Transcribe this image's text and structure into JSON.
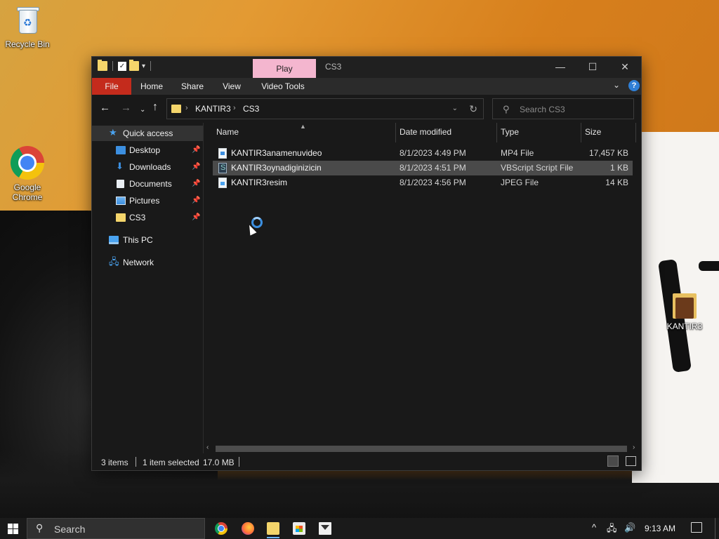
{
  "desktop": {
    "icons": [
      {
        "label": "Recycle Bin"
      },
      {
        "label": "Google Chrome"
      },
      {
        "label": "KANTIR3"
      }
    ]
  },
  "window": {
    "contextual_tab": "Play",
    "title": "CS3",
    "controls": {
      "minimize": "—",
      "maximize": "☐",
      "close": "✕"
    },
    "ribbon": {
      "tabs": [
        "File",
        "Home",
        "Share",
        "View",
        "Video Tools"
      ],
      "help": "?"
    },
    "address": {
      "crumbs": [
        "KANTIR3",
        "CS3"
      ]
    },
    "search": {
      "placeholder": "Search CS3"
    },
    "nav": {
      "items": [
        {
          "label": "Quick access",
          "icon": "star-icon"
        },
        {
          "label": "Desktop",
          "icon": "desktop-icon",
          "pinned": true
        },
        {
          "label": "Downloads",
          "icon": "download-icon",
          "pinned": true
        },
        {
          "label": "Documents",
          "icon": "documents-icon",
          "pinned": true
        },
        {
          "label": "Pictures",
          "icon": "pictures-icon",
          "pinned": true
        },
        {
          "label": "CS3",
          "icon": "folder-icon",
          "pinned": true
        },
        {
          "label": "This PC",
          "icon": "pc-icon"
        },
        {
          "label": "Network",
          "icon": "network-icon"
        }
      ]
    },
    "columns": [
      "Name",
      "Date modified",
      "Type",
      "Size"
    ],
    "files": [
      {
        "name": "KANTIR3anamenuvideo",
        "date": "8/1/2023 4:49 PM",
        "type": "MP4 File",
        "size": "17,457 KB",
        "icon": "video-file-icon"
      },
      {
        "name": "KANTIR3oynadiginizicin",
        "date": "8/1/2023 4:51 PM",
        "type": "VBScript Script File",
        "size": "1 KB",
        "icon": "script-file-icon",
        "selected": true
      },
      {
        "name": "KANTIR3resim",
        "date": "8/1/2023 4:56 PM",
        "type": "JPEG File",
        "size": "14 KB",
        "icon": "image-file-icon"
      }
    ],
    "status": {
      "count": "3 items",
      "selection": "1 item selected",
      "size": "17.0 MB"
    }
  },
  "taskbar": {
    "search_label": "Search",
    "apps": [
      "chrome-icon",
      "firefox-icon",
      "file-explorer-icon",
      "store-icon",
      "mail-icon"
    ],
    "time": "9:13 AM"
  }
}
